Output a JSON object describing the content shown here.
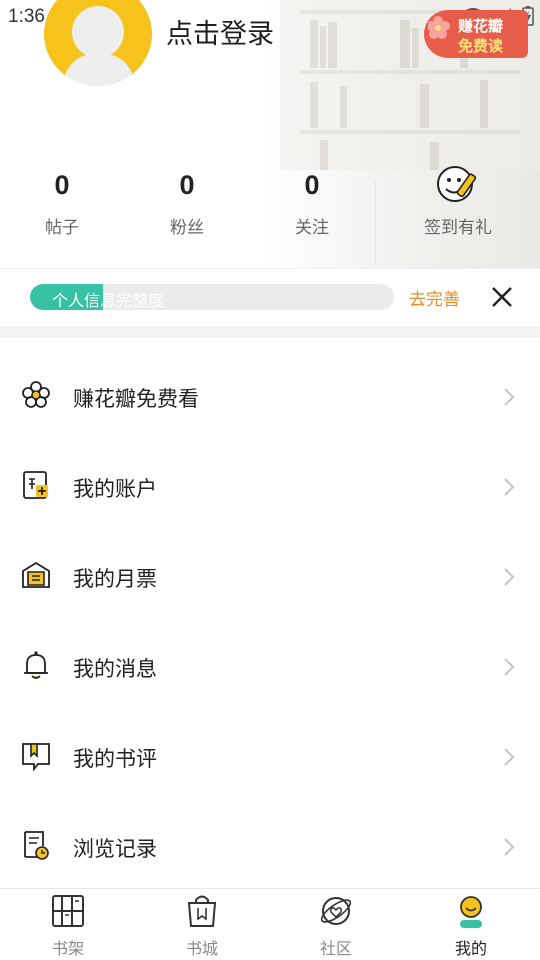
{
  "status_bar": {
    "time": "1:36"
  },
  "header": {
    "login_title": "点击登录",
    "promo": {
      "line1": "赚花瓣",
      "line2": "免费读"
    }
  },
  "stats": [
    {
      "value": "0",
      "label": "帖子"
    },
    {
      "value": "0",
      "label": "粉丝"
    },
    {
      "value": "0",
      "label": "关注"
    }
  ],
  "signin": {
    "label": "签到有礼",
    "icon": "signin-smiley-pen-icon"
  },
  "profile_progress": {
    "label": "个人信息完整度",
    "fraction": 0.2,
    "action": "去完善",
    "accent": "#38c2a4",
    "action_color": "#f08a1c"
  },
  "menu": [
    {
      "label": "赚花瓣免费看",
      "icon": "flower-icon"
    },
    {
      "label": "我的账户",
      "icon": "account-icon"
    },
    {
      "label": "我的月票",
      "icon": "ticket-icon"
    },
    {
      "label": "我的消息",
      "icon": "bell-icon"
    },
    {
      "label": "我的书评",
      "icon": "book-review-icon"
    },
    {
      "label": "浏览记录",
      "icon": "history-icon"
    }
  ],
  "tabs": [
    {
      "label": "书架",
      "icon": "bookshelf-icon"
    },
    {
      "label": "书城",
      "icon": "bookstore-bag-icon"
    },
    {
      "label": "社区",
      "icon": "community-planet-icon"
    },
    {
      "label": "我的",
      "icon": "me-avatar-icon",
      "active": true
    }
  ],
  "colors": {
    "brand_yellow": "#f6c21c",
    "promo_red": "#e85d4a"
  }
}
